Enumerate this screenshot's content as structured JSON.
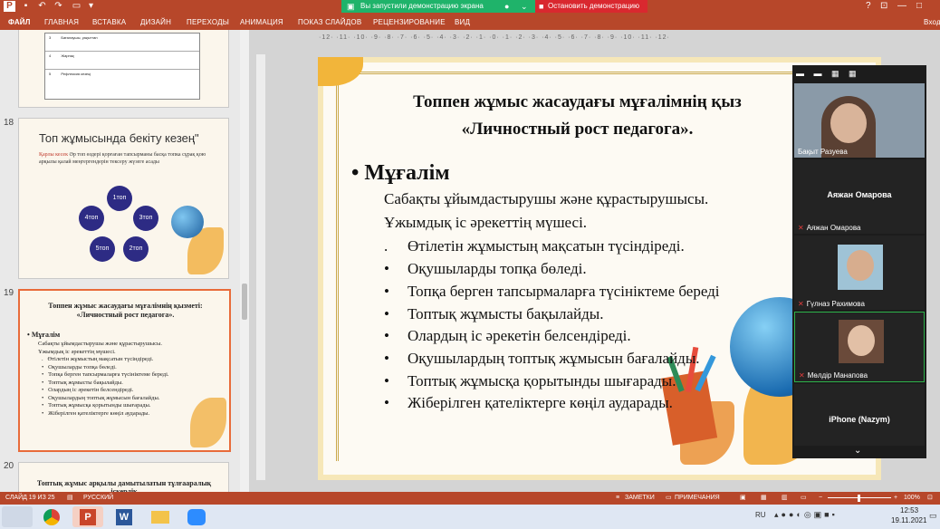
{
  "window": {
    "share_banner": "Вы запустили демонстрацию экрана",
    "stop_button": "Остановить демонстрацию",
    "title_controls": [
      "?",
      "⊡",
      "—",
      "□"
    ]
  },
  "ribbon": {
    "tabs": [
      "ФАЙЛ",
      "ГЛАВНАЯ",
      "ВСТАВКА",
      "ДИЗАЙН",
      "ПЕРЕХОДЫ",
      "АНИМАЦИЯ",
      "ПОКАЗ СЛАЙДОВ",
      "РЕЦЕНЗИРОВАНИЕ",
      "ВИД"
    ],
    "right_label": "Вход"
  },
  "thumbnails": {
    "numbers": [
      "18",
      "19",
      "20"
    ],
    "slide18": {
      "title": "Топ жұмысында бекіту кезең\"",
      "text_lead": "Қарлы кесек",
      "text": "Әр топ өздері қорғаған тапсырманы басқа топка сұрақ қою арқылы қалай меңгергендерін тексеру жүзеге асады",
      "nodes": [
        "1топ",
        "3топ",
        "2топ",
        "5топ",
        "4топ"
      ]
    },
    "slide19": {
      "title": "Топпен жұмыс жасаудағы мұғалімнің қызметі: «Личностный рост педагога».",
      "bullet": "Мұғалім",
      "lines": [
        "Сабақты ұйымдастырушы және құрастырушысы.",
        "Ұжымдық іс әрекеттің мүшесі.",
        "Өтілетін жұмыстың мақсатын түсіндіреді.",
        "Оқушыларды топқа бөледі.",
        "Топқа берген тапсырмаларға түсініктеме береді.",
        "Топтық жұмысты бақылайды.",
        "Олардың іс әрекетін белсендіреді.",
        "Оқушылардың топтық жұмысын бағалайды.",
        "Топтық жұмысқа қорытынды шығарады.",
        "Жіберілген қателіктерге көңіл аударады."
      ]
    },
    "slide20_title": "Топтық жұмыс арқылы дамытылатын тұлғааралық іскерлік",
    "prev_rows": [
      {
        "n": "3",
        "t": "Бағалаушы, уақыттан"
      },
      {
        "n": "4",
        "t": "Жарнақ"
      },
      {
        "n": "5",
        "t": "Рефлексия кезеңі"
      }
    ]
  },
  "ruler": "·12· ·11· ·10· ·9· ·8· ·7· ·6· ·5· ·4· ·3· ·2· ·1· ·0· ·1· ·2· ·3· ·4· ·5· ·6· ·7· ·8· ·9· ·10· ·11· ·12·",
  "slide": {
    "title_line1": "Топпен жұмыс жасаудағы мұғалімнің қыз",
    "title_line2": "«Личностный рост педагога».",
    "bullet": "Мұғалім",
    "lines": [
      "Сабақты ұйымдастырушы және құрастырушысы.",
      "Ұжымдық  іс әрекеттің мүшесі."
    ],
    "items": [
      "Өтілетін жұмыстың мақсатын түсіндіреді.",
      "Оқушыларды топқа бөледі.",
      "Топқа берген тапсырмаларға түсініктеме береді",
      "Топтық жұмысты бақылайды.",
      "Олардың іс әрекетін белсендіреді.",
      "Оқушылардың топтық жұмысын бағалайды.",
      "Топтық жұмысқа қорытынды шығарады.",
      "Жіберілген қателіктерге көңіл аударады."
    ]
  },
  "zoom": {
    "participants": [
      {
        "name": "Бақыт Разуева",
        "big": ""
      },
      {
        "name": "Аяжан Омарова",
        "big": "Аяжан Омарова"
      },
      {
        "name": "Гүлназ Рахимова",
        "big": ""
      },
      {
        "name": "Мөлдір Манапова",
        "big": ""
      },
      {
        "name": "",
        "big": "iPhone (Nazym)"
      }
    ]
  },
  "status": {
    "slide": "СЛАЙД 19 ИЗ 25",
    "language": "РУССКИЙ",
    "notes": "ЗАМЕТКИ",
    "comments": "ПРИМЕЧАНИЯ",
    "zoom": "100%"
  },
  "taskbar": {
    "lang": "RU",
    "time": "12:53",
    "date": "19.11.2021"
  },
  "colors": {
    "ppt_red": "#b7472a",
    "share_green": "#1fb36a",
    "stop_red": "#d9282f",
    "selected_border": "#e86b3a"
  }
}
